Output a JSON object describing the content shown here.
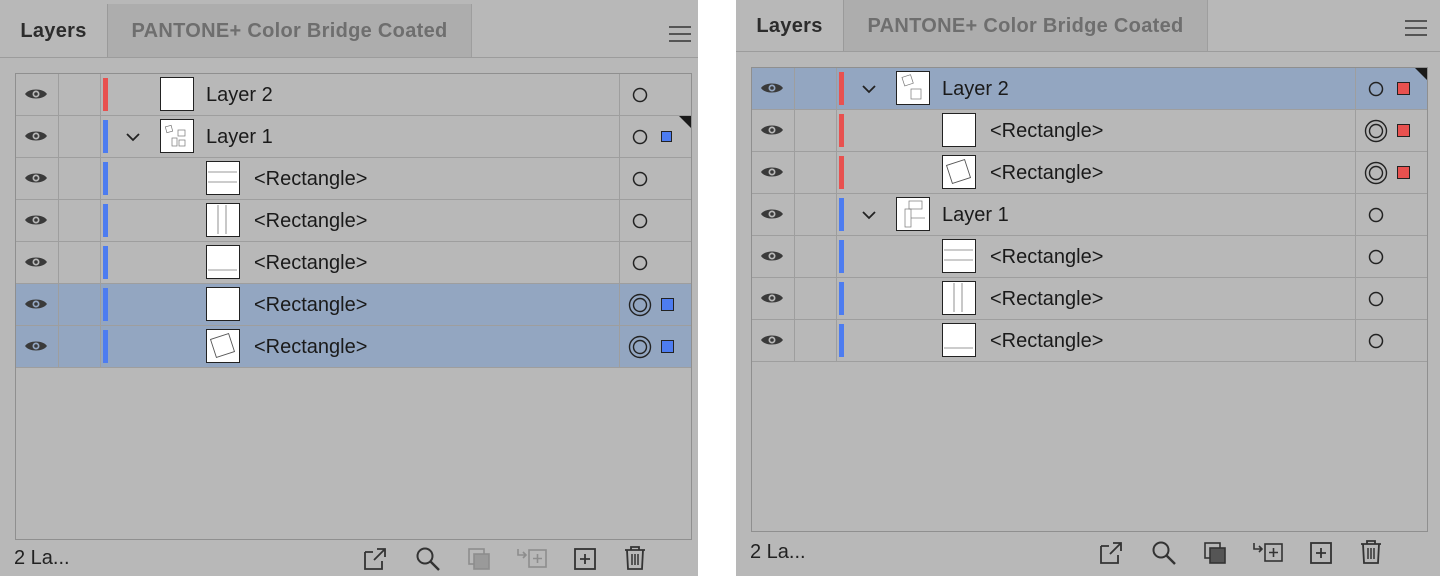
{
  "colors": {
    "red_layer": "#e8514f",
    "blue_layer": "#4d7cf0",
    "selection": "#93a6c1",
    "panel_bg": "#b8b8b8"
  },
  "left_panel": {
    "tabs": [
      "Layers",
      "PANTONE+ Color Bridge Coated"
    ],
    "status_text": "2 La...",
    "rows": [
      {
        "name": "Layer 2",
        "kind": "layer",
        "layer_color": "red",
        "expanded": false,
        "selected": false,
        "targeted": false,
        "selection_square": false
      },
      {
        "name": "Layer 1",
        "kind": "layer",
        "layer_color": "blue",
        "expanded": true,
        "selected": false,
        "targeted": false,
        "selection_square": true
      },
      {
        "name": "<Rectangle>",
        "kind": "object",
        "layer_color": "blue",
        "selected": false,
        "targeted": false
      },
      {
        "name": "<Rectangle>",
        "kind": "object",
        "layer_color": "blue",
        "selected": false,
        "targeted": false
      },
      {
        "name": "<Rectangle>",
        "kind": "object",
        "layer_color": "blue",
        "selected": false,
        "targeted": false
      },
      {
        "name": "<Rectangle>",
        "kind": "object",
        "layer_color": "blue",
        "selected": true,
        "targeted": true
      },
      {
        "name": "<Rectangle>",
        "kind": "object",
        "layer_color": "blue",
        "selected": true,
        "targeted": true
      }
    ],
    "footer_icons": [
      "collect-export-icon",
      "locate-object-icon",
      "make-clipping-mask-icon",
      "create-sublayer-icon",
      "create-new-layer-icon",
      "trash-icon"
    ]
  },
  "right_panel": {
    "tabs": [
      "Layers",
      "PANTONE+ Color Bridge Coated"
    ],
    "status_text": "2 La...",
    "rows": [
      {
        "name": "Layer 2",
        "kind": "layer",
        "layer_color": "red",
        "expanded": true,
        "selected": true,
        "targeted": false
      },
      {
        "name": "<Rectangle>",
        "kind": "object",
        "layer_color": "red",
        "selected": false,
        "targeted": true
      },
      {
        "name": "<Rectangle>",
        "kind": "object",
        "layer_color": "red",
        "selected": false,
        "targeted": true
      },
      {
        "name": "Layer 1",
        "kind": "layer",
        "layer_color": "blue",
        "expanded": true,
        "selected": false,
        "targeted": false
      },
      {
        "name": "<Rectangle>",
        "kind": "object",
        "layer_color": "blue",
        "selected": false,
        "targeted": false
      },
      {
        "name": "<Rectangle>",
        "kind": "object",
        "layer_color": "blue",
        "selected": false,
        "targeted": false
      },
      {
        "name": "<Rectangle>",
        "kind": "object",
        "layer_color": "blue",
        "selected": false,
        "targeted": false
      }
    ],
    "footer_icons": [
      "collect-export-icon",
      "locate-object-icon",
      "make-clipping-mask-icon",
      "create-sublayer-icon",
      "create-new-layer-icon",
      "trash-icon"
    ]
  }
}
